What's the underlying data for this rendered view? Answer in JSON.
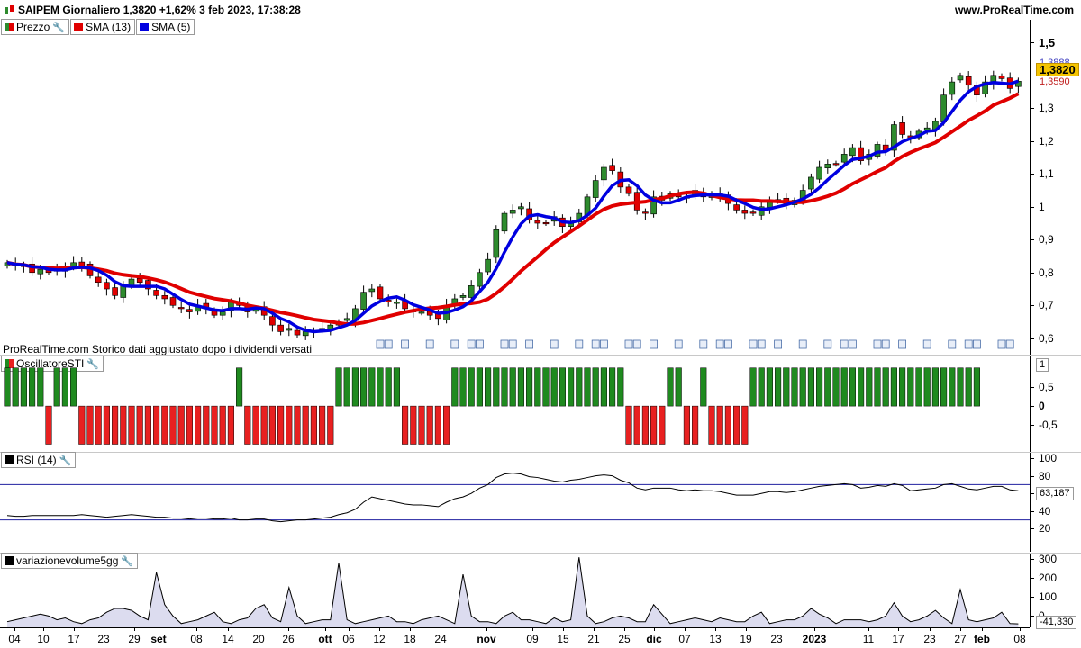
{
  "title": {
    "text": "SAIPEM Giornaliero 1,3820 +1,62% 3 feb 2023, 17:38:28",
    "site": "www.ProRealTime.com"
  },
  "legend_main": [
    {
      "label": "Prezzo",
      "color": "#2e8b2e",
      "icon": "wrench-icon"
    },
    {
      "label": "SMA (13)",
      "color": "#e00000"
    },
    {
      "label": "SMA (5)",
      "color": "#0000e0"
    }
  ],
  "footnote": "ProRealTime.com  Storico dati aggiustato dopo i dividendi versati",
  "price_axis": {
    "ticks": [
      "1,5",
      "1,4",
      "1,3",
      "1,2",
      "1,1",
      "1",
      "0,9",
      "0,8",
      "0,7",
      "0,6"
    ],
    "high_label": "1,3888",
    "last_label": "1,3820",
    "low_label": "1,3590",
    "last_color": "#f4c400"
  },
  "osc_panel": {
    "label": "OscillatoreSTI",
    "ticks": [
      "0,5",
      "0",
      "-0,5"
    ],
    "badge": "1",
    "pos_color": "#1f8a1f",
    "neg_color": "#e82020"
  },
  "rsi_panel": {
    "label": "RSI (14)",
    "ticks": [
      "100",
      "80",
      "60",
      "40",
      "20"
    ],
    "value_label": "63,187",
    "levels": [
      70,
      30
    ],
    "level_color": "#2020a0"
  },
  "vol_panel": {
    "label": "variazionevolume5gg",
    "ticks": [
      "300",
      "200",
      "100",
      "0"
    ],
    "value_label": "-41,330",
    "fill_color": "#dcdcef"
  },
  "x_axis": {
    "labels": [
      "04",
      "10",
      "17",
      "23",
      "29",
      "set",
      "08",
      "14",
      "20",
      "26",
      "ott",
      "06",
      "12",
      "18",
      "24",
      "nov",
      "09",
      "15",
      "21",
      "25",
      "dic",
      "07",
      "13",
      "19",
      "23",
      "2023",
      "11",
      "17",
      "23",
      "27",
      "feb",
      "08"
    ],
    "bold": [
      "set",
      "ott",
      "nov",
      "dic",
      "2023",
      "feb"
    ]
  },
  "chart_data": {
    "type": "candlestick",
    "n_bars": 112,
    "price": {
      "ylim": [
        0.55,
        1.52
      ],
      "close": [
        0.83,
        0.82,
        0.82,
        0.8,
        0.81,
        0.8,
        0.81,
        0.82,
        0.83,
        0.82,
        0.79,
        0.77,
        0.75,
        0.73,
        0.76,
        0.78,
        0.77,
        0.75,
        0.73,
        0.72,
        0.7,
        0.69,
        0.68,
        0.7,
        0.69,
        0.67,
        0.68,
        0.71,
        0.7,
        0.68,
        0.69,
        0.67,
        0.64,
        0.62,
        0.63,
        0.61,
        0.62,
        0.62,
        0.63,
        0.64,
        0.65,
        0.66,
        0.69,
        0.74,
        0.75,
        0.72,
        0.71,
        0.71,
        0.69,
        0.68,
        0.68,
        0.67,
        0.66,
        0.7,
        0.72,
        0.73,
        0.76,
        0.8,
        0.84,
        0.93,
        0.98,
        0.99,
        1.0,
        0.96,
        0.95,
        0.95,
        0.97,
        0.94,
        0.95,
        0.98,
        1.03,
        1.08,
        1.12,
        1.11,
        1.06,
        1.04,
        0.99,
        0.98,
        1.03,
        1.02,
        1.04,
        1.03,
        1.03,
        1.05,
        1.03,
        1.04,
        1.03,
        1.01,
        0.99,
        0.98,
        0.98,
        1.0,
        1.02,
        1.02,
        1.01,
        1.02,
        1.05,
        1.09,
        1.12,
        1.13,
        1.13,
        1.16,
        1.18,
        1.14,
        1.16,
        1.19,
        1.17,
        1.25,
        1.22,
        1.21,
        1.23,
        1.24,
        1.26,
        1.34,
        1.38,
        1.4,
        1.37,
        1.34,
        1.38,
        1.4,
        1.39,
        1.36,
        1.382
      ],
      "sma13_label": "SMA (13)",
      "sma5_label": "SMA (5)"
    },
    "osc": {
      "values": [
        1,
        1,
        1,
        1,
        1,
        -1,
        1,
        1,
        1,
        -1,
        -1,
        -1,
        -1,
        -1,
        -1,
        -1,
        -1,
        -1,
        -1,
        -1,
        -1,
        -1,
        -1,
        -1,
        -1,
        -1,
        -1,
        -1,
        1,
        -1,
        -1,
        -1,
        -1,
        -1,
        -1,
        -1,
        -1,
        -1,
        -1,
        -1,
        1,
        1,
        1,
        1,
        1,
        1,
        1,
        1,
        -1,
        -1,
        -1,
        -1,
        -1,
        -1,
        1,
        1,
        1,
        1,
        1,
        1,
        1,
        1,
        1,
        1,
        1,
        1,
        1,
        1,
        1,
        1,
        1,
        1,
        1,
        1,
        1,
        -1,
        -1,
        -1,
        -1,
        -1,
        1,
        1,
        -1,
        -1,
        1,
        -1,
        -1,
        -1,
        -1,
        -1,
        1,
        1,
        1,
        1,
        1,
        1,
        1,
        1,
        1,
        1,
        1,
        1,
        1,
        1,
        1,
        1,
        1,
        1,
        1,
        1,
        1,
        1,
        1,
        1,
        1,
        1,
        1,
        1
      ],
      "ylim": [
        -1.2,
        1.3
      ]
    },
    "rsi": {
      "values": [
        35,
        34,
        34,
        35,
        35,
        35,
        35,
        35,
        35,
        36,
        35,
        34,
        33,
        34,
        35,
        36,
        35,
        34,
        33,
        33,
        32,
        32,
        31,
        32,
        32,
        31,
        31,
        32,
        30,
        30,
        31,
        31,
        29,
        28,
        29,
        30,
        30,
        31,
        32,
        33,
        36,
        38,
        42,
        50,
        56,
        54,
        52,
        50,
        48,
        47,
        47,
        46,
        45,
        50,
        54,
        56,
        60,
        66,
        70,
        78,
        82,
        83,
        82,
        79,
        78,
        76,
        74,
        73,
        75,
        76,
        78,
        80,
        81,
        80,
        75,
        72,
        66,
        64,
        66,
        66,
        66,
        64,
        63,
        64,
        63,
        63,
        62,
        60,
        58,
        58,
        58,
        60,
        62,
        62,
        61,
        62,
        64,
        66,
        68,
        69,
        70,
        71,
        70,
        66,
        67,
        69,
        68,
        71,
        69,
        63,
        64,
        65,
        66,
        70,
        71,
        68,
        65,
        64,
        66,
        68,
        68,
        64,
        63
      ],
      "ylim": [
        0,
        100
      ]
    },
    "volume": {
      "values": [
        -30,
        -20,
        -10,
        0,
        10,
        0,
        -20,
        -10,
        -30,
        -40,
        -20,
        -10,
        20,
        40,
        40,
        30,
        0,
        -20,
        230,
        60,
        0,
        -40,
        -30,
        -20,
        0,
        20,
        -30,
        -40,
        -20,
        -10,
        40,
        60,
        -10,
        -30,
        150,
        0,
        -40,
        -30,
        -20,
        -20,
        280,
        -20,
        -40,
        -30,
        -20,
        -10,
        0,
        -30,
        -30,
        -40,
        -20,
        -10,
        0,
        -20,
        -40,
        220,
        0,
        -30,
        -30,
        -40,
        0,
        20,
        -20,
        -20,
        -30,
        -40,
        -10,
        -30,
        -20,
        310,
        0,
        -40,
        -30,
        -10,
        0,
        -10,
        -30,
        -30,
        60,
        10,
        -40,
        -30,
        -20,
        -10,
        -20,
        -30,
        -10,
        -20,
        -30,
        -30,
        0,
        20,
        -40,
        -30,
        -20,
        -20,
        0,
        40,
        10,
        -10,
        -40,
        -20,
        -20,
        -20,
        -30,
        -20,
        0,
        70,
        0,
        -30,
        -20,
        0,
        30,
        -10,
        -40,
        140,
        -20,
        -30,
        -20,
        -10,
        20,
        -40,
        -41.33
      ],
      "ylim": [
        -60,
        330
      ]
    }
  }
}
